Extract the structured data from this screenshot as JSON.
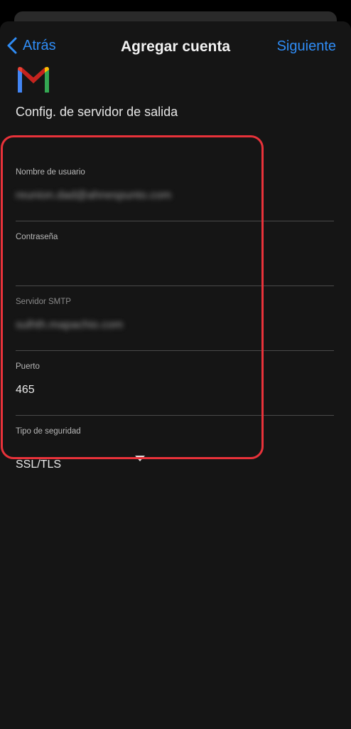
{
  "nav": {
    "back_label": "Atrás",
    "title": "Agregar cuenta",
    "next_label": "Siguiente"
  },
  "header": {
    "logo_icon": "gmail-logo-icon",
    "subtitle": "Config. de servidor de salida"
  },
  "form": {
    "username": {
      "label": "Nombre de usuario",
      "value": "reunion.dad@ahnespunto.com"
    },
    "password": {
      "label": "Contraseña",
      "value": ""
    },
    "smtp": {
      "label": "Servidor SMTP",
      "value": "sulhth.mapachio.com"
    },
    "port": {
      "label": "Puerto",
      "value": "465"
    },
    "security": {
      "label": "Tipo de seguridad",
      "value": "SSL/TLS"
    }
  },
  "colors": {
    "accent": "#2f8cf5",
    "highlight": "#e8323a",
    "background": "#151515"
  }
}
